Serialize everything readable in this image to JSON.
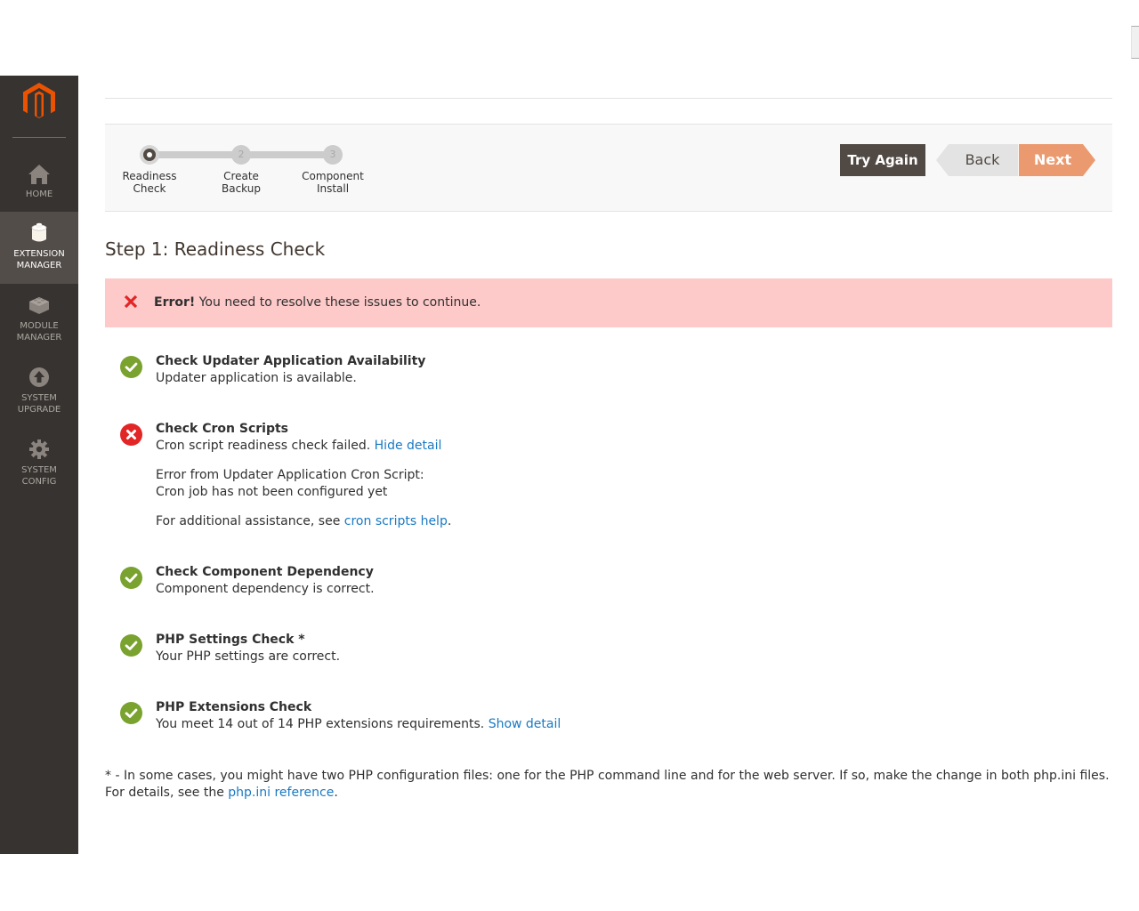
{
  "sidebar": {
    "logo": "magento-logo",
    "items": [
      {
        "label_line1": "HOME",
        "label_line2": "",
        "icon": "home-icon",
        "active": false
      },
      {
        "label_line1": "EXTENSION",
        "label_line2": "MANAGER",
        "icon": "extension-box-icon",
        "active": true
      },
      {
        "label_line1": "MODULE",
        "label_line2": "MANAGER",
        "icon": "module-block-icon",
        "active": false
      },
      {
        "label_line1": "SYSTEM",
        "label_line2": "UPGRADE",
        "icon": "upgrade-arrow-icon",
        "active": false
      },
      {
        "label_line1": "SYSTEM",
        "label_line2": "CONFIG",
        "icon": "gear-icon",
        "active": false
      }
    ]
  },
  "wizard": {
    "steps": [
      {
        "number": "1",
        "line1": "Readiness",
        "line2": "Check",
        "state": "current"
      },
      {
        "number": "2",
        "line1": "Create",
        "line2": "Backup",
        "state": "pending"
      },
      {
        "number": "3",
        "line1": "Component",
        "line2": "Install",
        "state": "pending"
      }
    ],
    "buttons": {
      "try_again": "Try Again",
      "back": "Back",
      "next": "Next"
    }
  },
  "page": {
    "title": "Step 1: Readiness Check"
  },
  "error": {
    "strong": "Error!",
    "message": " You need to resolve these issues to continue.",
    "icon": "error-x-icon"
  },
  "checks": [
    {
      "status": "success",
      "title": "Check Updater Application Availability",
      "description": "Updater application is available."
    },
    {
      "status": "error",
      "title": "Check Cron Scripts",
      "description": "Cron script readiness check failed.",
      "link": "Hide detail",
      "detail_line1": "Error from Updater Application Cron Script:",
      "detail_line2": "Cron job has not been configured yet",
      "help_prefix": "For additional assistance, see ",
      "help_link": "cron scripts help",
      "help_suffix": "."
    },
    {
      "status": "success",
      "title": "Check Component Dependency",
      "description": "Component dependency is correct."
    },
    {
      "status": "success",
      "title": "PHP Settings Check *",
      "description": "Your PHP settings are correct."
    },
    {
      "status": "success",
      "title": "PHP Extensions Check",
      "description": "You meet 14 out of 14 PHP extensions requirements.",
      "link": "Show detail"
    }
  ],
  "footnote": {
    "text": "* - In some cases, you might have two PHP configuration files: one for the PHP command line and for the web server. If so, make the change in both php.ini files. For details, see the ",
    "link": "php.ini reference",
    "suffix": "."
  },
  "colors": {
    "sidebar_bg": "#373330",
    "sidebar_active_bg": "#524d49",
    "brand_orange": "#eb5202",
    "success_green": "#79a22e",
    "error_red": "#e22626",
    "error_bg": "#fdc9c9",
    "link_blue": "#1979c3",
    "next_button": "#eb9a6f",
    "try_again_button": "#514943"
  }
}
